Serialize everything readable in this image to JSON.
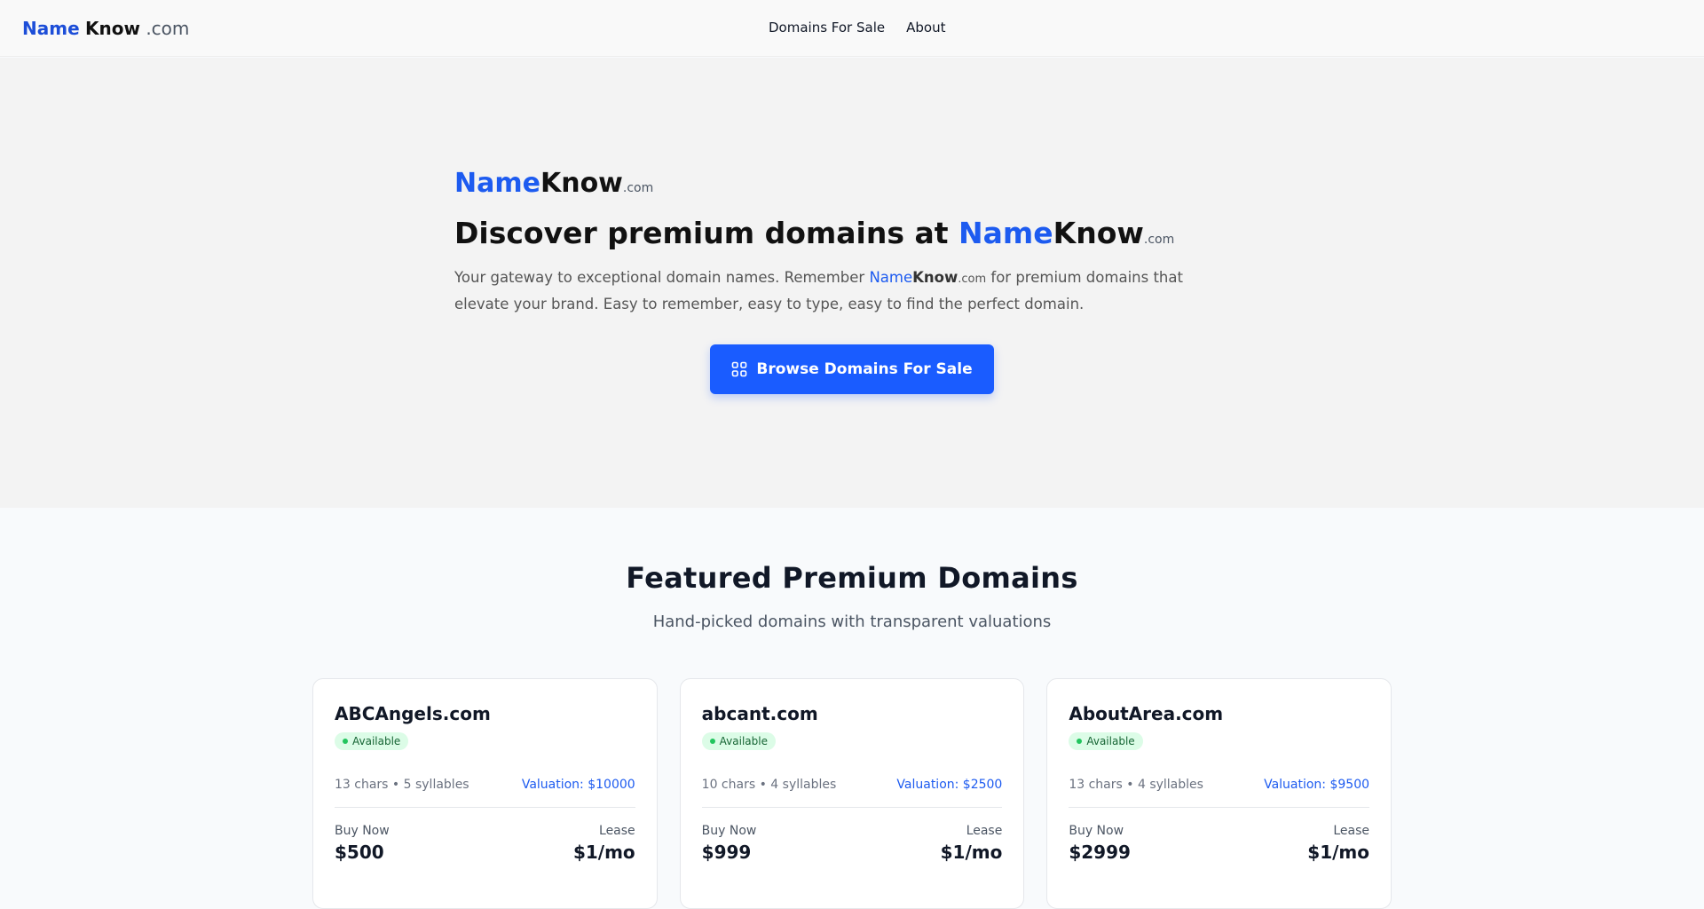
{
  "header": {
    "logo": {
      "part1": "Name",
      "part2": "Know",
      "part3": ".com"
    },
    "nav": [
      {
        "label": "Domains For Sale"
      },
      {
        "label": "About"
      }
    ]
  },
  "hero": {
    "logo": {
      "part1": "Name",
      "part2": "Know",
      "part3": ".com"
    },
    "title_prefix": "Discover premium domains at",
    "title_brand": {
      "part1": "Name",
      "part2": "Know",
      "part3": ".com"
    },
    "desc_before": "Your gateway to exceptional domain names. Remember ",
    "desc_brand": {
      "part1": "Name",
      "part2": "Know",
      "part3": ".com"
    },
    "desc_after": " for premium domains that elevate your brand. Easy to remember, easy to type, easy to find the perfect domain.",
    "cta_label": "Browse Domains For Sale",
    "cta_icon": "grid-icon"
  },
  "featured": {
    "title": "Featured Premium Domains",
    "subtitle": "Hand-picked domains with transparent valuations",
    "cards": [
      {
        "name": "ABCAngels.com",
        "status": "Available",
        "info": "13 chars • 5 syllables",
        "valuation": "Valuation: $10000",
        "buy_label": "Buy Now",
        "buy_price": "$500",
        "lease_label": "Lease",
        "lease_price": "$1/mo"
      },
      {
        "name": "abcant.com",
        "status": "Available",
        "info": "10 chars • 4 syllables",
        "valuation": "Valuation: $2500",
        "buy_label": "Buy Now",
        "buy_price": "$999",
        "lease_label": "Lease",
        "lease_price": "$1/mo"
      },
      {
        "name": "AboutArea.com",
        "status": "Available",
        "info": "13 chars • 4 syllables",
        "valuation": "Valuation: $9500",
        "buy_label": "Buy Now",
        "buy_price": "$2999",
        "lease_label": "Lease",
        "lease_price": "$1/mo"
      }
    ]
  },
  "colors": {
    "brand_blue": "#1d5bf0",
    "cta_blue": "#1a5cff",
    "available_green": "#22c55e"
  }
}
